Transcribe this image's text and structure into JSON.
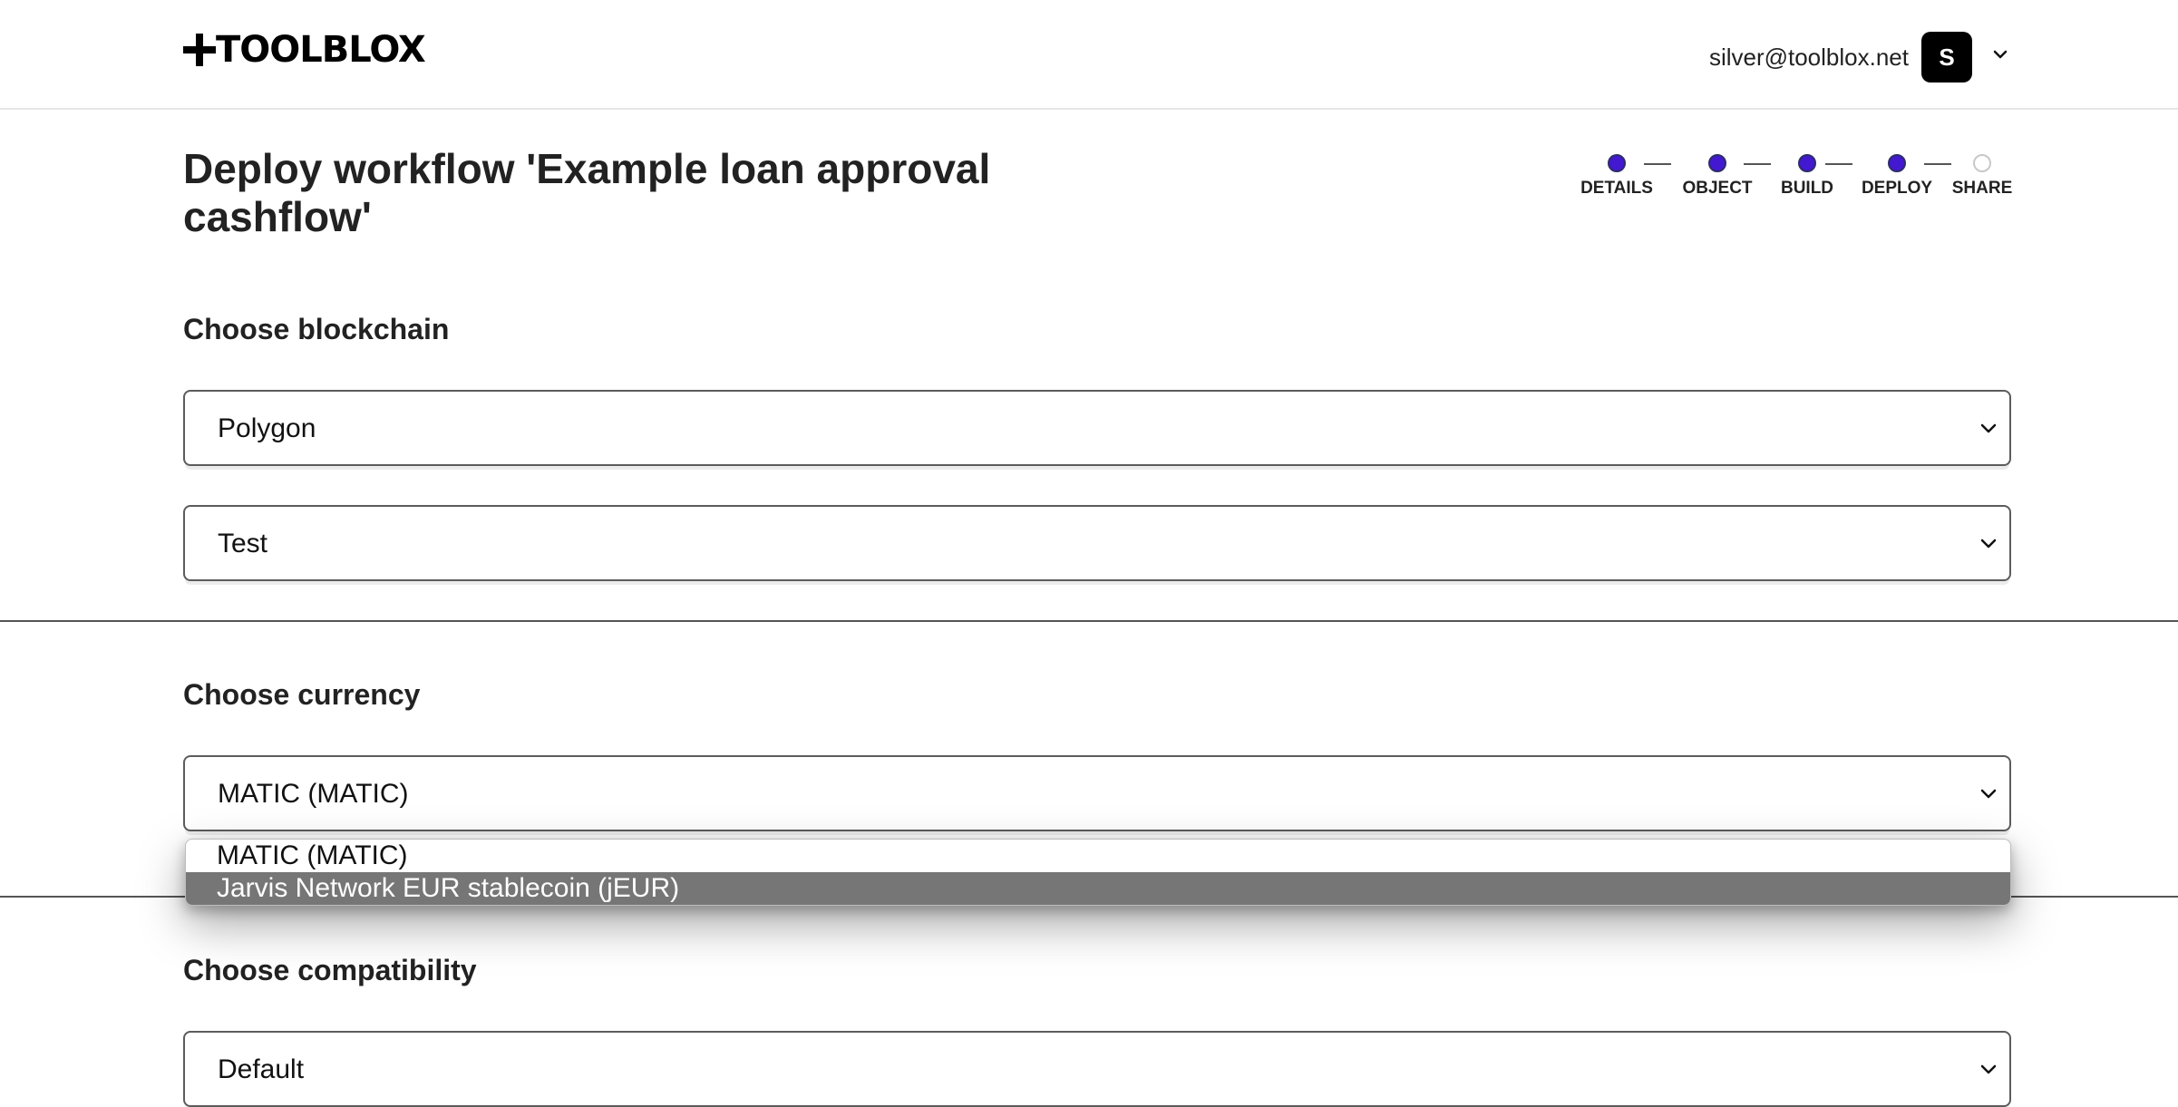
{
  "header": {
    "logo_text": "TOOLBLOX",
    "user_email": "silver@toolblox.net",
    "avatar_initial": "S"
  },
  "page": {
    "title": "Deploy workflow 'Example loan approval cashflow'"
  },
  "stepper": {
    "steps": [
      {
        "label": "DETAILS",
        "state": "done"
      },
      {
        "label": "OBJECT",
        "state": "done"
      },
      {
        "label": "BUILD",
        "state": "done"
      },
      {
        "label": "DEPLOY",
        "state": "done"
      },
      {
        "label": "SHARE",
        "state": "pending"
      }
    ],
    "active_color": "#4318d1"
  },
  "blockchain": {
    "label": "Choose blockchain",
    "network_value": "Polygon",
    "environment_value": "Test"
  },
  "currency": {
    "label": "Choose currency",
    "value": "MATIC (MATIC)",
    "options": [
      "MATIC (MATIC)",
      "Jarvis Network EUR stablecoin (jEUR)"
    ],
    "highlighted_option": "Jarvis Network EUR stablecoin (jEUR)"
  },
  "compatibility": {
    "label": "Choose compatibility",
    "value": "Default"
  }
}
